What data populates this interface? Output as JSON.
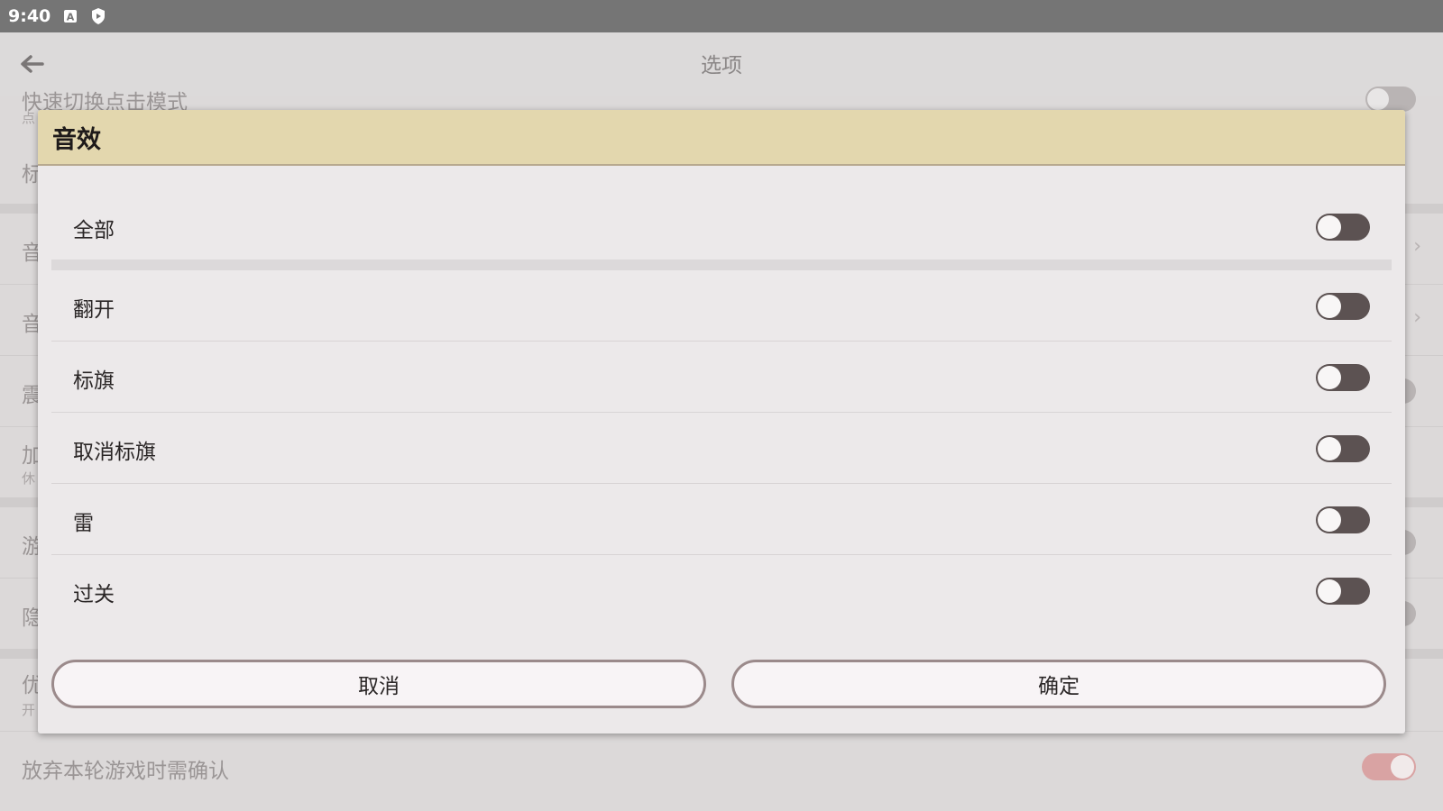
{
  "status_bar": {
    "time": "9:40",
    "icons": [
      "a-box-icon",
      "shield-icon"
    ]
  },
  "app_bar": {
    "title": "选项",
    "back_icon": "back-arrow-icon"
  },
  "background_list": {
    "rows": [
      {
        "label": "快速切换点击模式",
        "subtitle": "点"
      },
      {
        "label": "标"
      },
      {
        "label": "音"
      },
      {
        "label": "音"
      },
      {
        "label": "震"
      },
      {
        "label": "加",
        "subtitle": "休"
      },
      {
        "label": "游"
      },
      {
        "label": "隐"
      },
      {
        "label": "优",
        "subtitle": "开"
      },
      {
        "label": "放弃本轮游戏时需确认"
      }
    ]
  },
  "dialog": {
    "title": "音效",
    "options": [
      {
        "label": "全部",
        "checked": false
      },
      {
        "label": "翻开",
        "checked": false
      },
      {
        "label": "标旗",
        "checked": false
      },
      {
        "label": "取消标旗",
        "checked": false
      },
      {
        "label": "雷",
        "checked": false
      },
      {
        "label": "过关",
        "checked": false
      }
    ],
    "cancel_label": "取消",
    "ok_label": "确定"
  },
  "colors": {
    "dialog_header": "#e3d7ae",
    "toggle_track_off": "#5c5252",
    "button_border": "#9b8a8b"
  }
}
